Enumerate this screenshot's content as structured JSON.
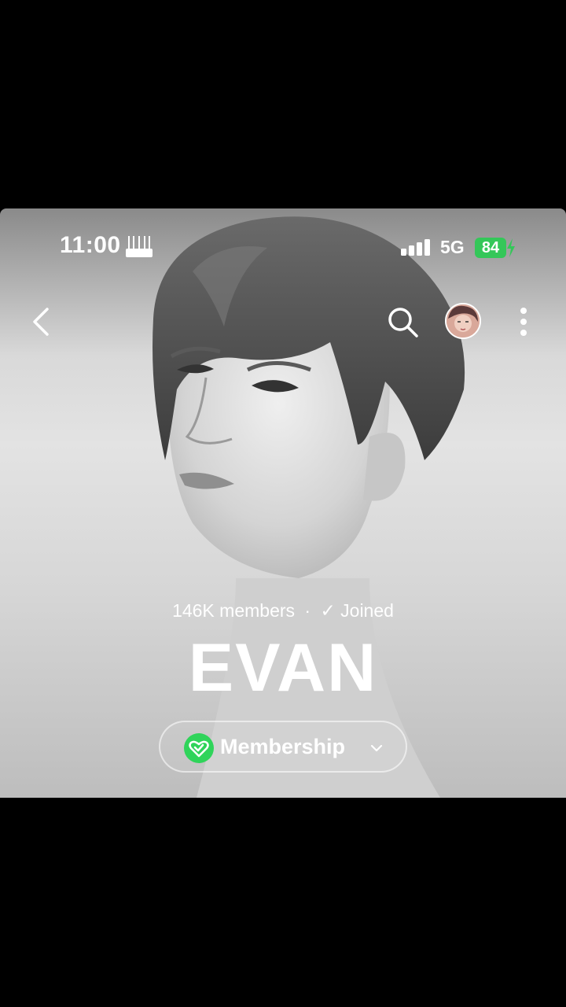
{
  "status_bar": {
    "time": "11:00",
    "network": "5G",
    "battery": "84"
  },
  "community": {
    "members_count": "146K members",
    "separator": "·",
    "joined_label": "✓ Joined",
    "name": "EVAN",
    "membership_label": "Membership"
  },
  "colors": {
    "battery_green": "#34c759",
    "membership_green": "#2fd45a"
  },
  "icons": {
    "back": "chevron-left-icon",
    "search": "search-icon",
    "more": "more-vertical-icon",
    "membership": "heart-check-icon",
    "dropdown": "chevron-down-icon"
  }
}
